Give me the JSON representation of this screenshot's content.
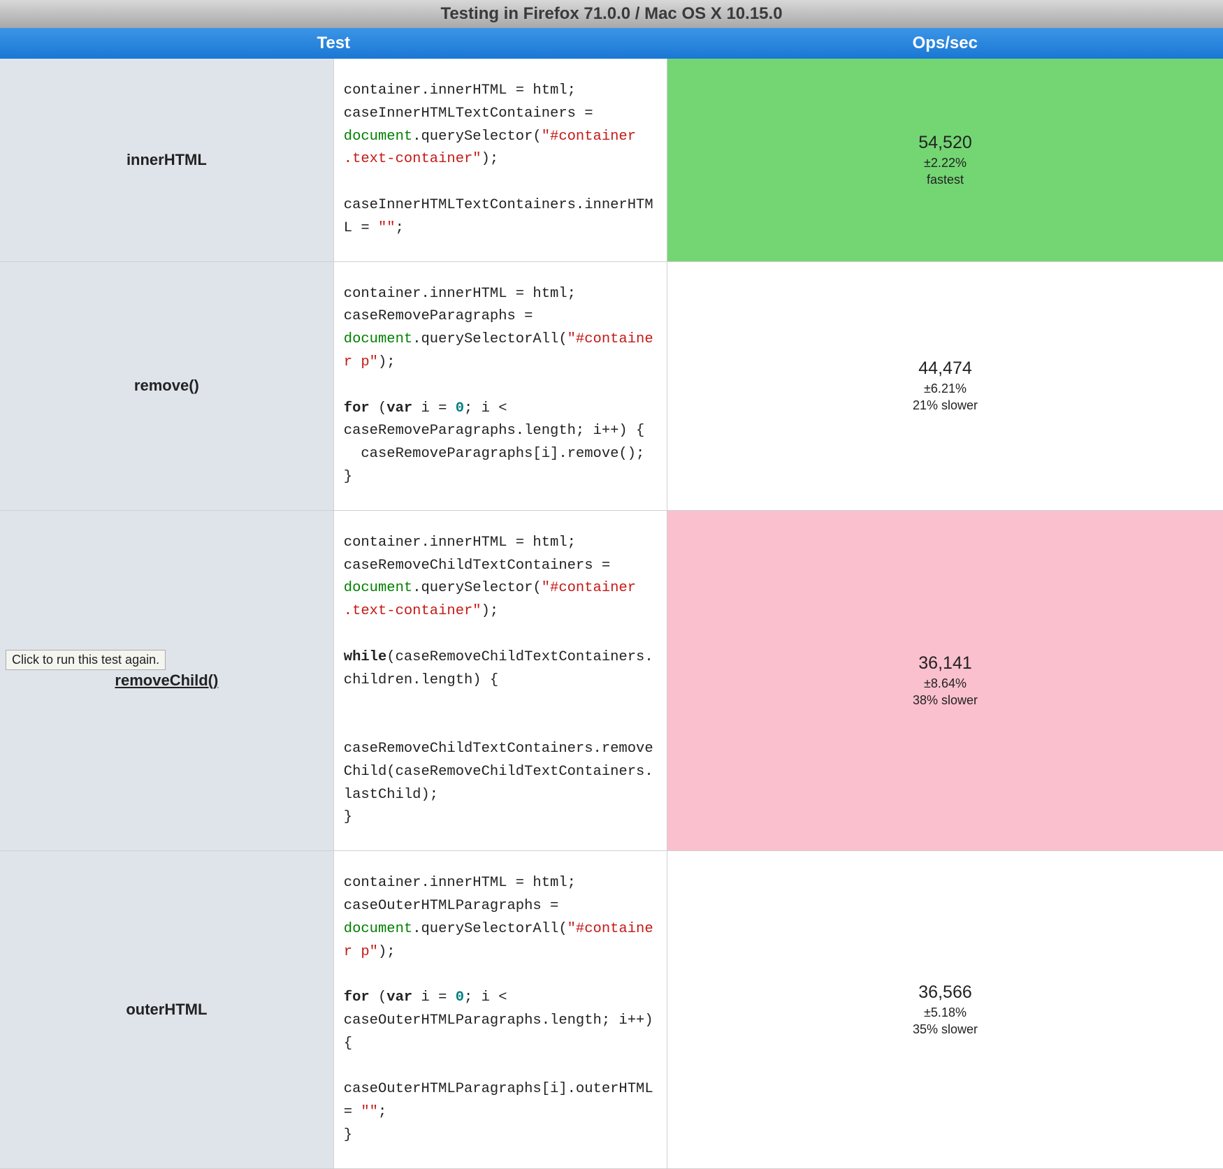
{
  "title": "Testing in Firefox 71.0.0 / Mac OS X 10.15.0",
  "headers": {
    "test": "Test",
    "ops": "Ops/sec"
  },
  "tooltip": "Click to run this test again.",
  "rows": [
    {
      "name": "innerHTML",
      "highlighted": false,
      "code_tokens": [
        {
          "t": "container.innerHTML = html;\ncaseInnerHTMLTextContainers = "
        },
        {
          "t": "document",
          "c": "tok-builtin"
        },
        {
          "t": ".querySelector("
        },
        {
          "t": "\"#container .text-container\"",
          "c": "tok-str"
        },
        {
          "t": ");\n\ncaseInnerHTMLTextContainers.innerHTML = "
        },
        {
          "t": "\"\"",
          "c": "tok-str"
        },
        {
          "t": ";"
        }
      ],
      "ops": "54,520",
      "err": "±2.22%",
      "rank": "fastest",
      "rank_class": "fastest"
    },
    {
      "name": "remove()",
      "highlighted": false,
      "code_tokens": [
        {
          "t": "container.innerHTML = html;\ncaseRemoveParagraphs = "
        },
        {
          "t": "document",
          "c": "tok-builtin"
        },
        {
          "t": ".querySelectorAll("
        },
        {
          "t": "\"#container p\"",
          "c": "tok-str"
        },
        {
          "t": ");\n\n"
        },
        {
          "t": "for",
          "c": "tok-kw"
        },
        {
          "t": " ("
        },
        {
          "t": "var",
          "c": "tok-kw"
        },
        {
          "t": " i = "
        },
        {
          "t": "0",
          "c": "tok-num"
        },
        {
          "t": "; i < caseRemoveParagraphs.length; i++) {\n  caseRemoveParagraphs[i].remove();\n}"
        }
      ],
      "ops": "44,474",
      "err": "±6.21%",
      "rank": "21% slower",
      "rank_class": ""
    },
    {
      "name": "removeChild()",
      "highlighted": true,
      "code_tokens": [
        {
          "t": "container.innerHTML = html;\ncaseRemoveChildTextContainers = "
        },
        {
          "t": "document",
          "c": "tok-builtin"
        },
        {
          "t": ".querySelector("
        },
        {
          "t": "\"#container .text-container\"",
          "c": "tok-str"
        },
        {
          "t": ");\n\n"
        },
        {
          "t": "while",
          "c": "tok-kw"
        },
        {
          "t": "(caseRemoveChildTextContainers.children.length) {\n\n\ncaseRemoveChildTextContainers.removeChild(caseRemoveChildTextContainers.lastChild);\n}"
        }
      ],
      "ops": "36,141",
      "err": "±8.64%",
      "rank": "38% slower",
      "rank_class": "slowest"
    },
    {
      "name": "outerHTML",
      "highlighted": false,
      "code_tokens": [
        {
          "t": "container.innerHTML = html;\ncaseOuterHTMLParagraphs = "
        },
        {
          "t": "document",
          "c": "tok-builtin"
        },
        {
          "t": ".querySelectorAll("
        },
        {
          "t": "\"#container p\"",
          "c": "tok-str"
        },
        {
          "t": ");\n\n"
        },
        {
          "t": "for",
          "c": "tok-kw"
        },
        {
          "t": " ("
        },
        {
          "t": "var",
          "c": "tok-kw"
        },
        {
          "t": " i = "
        },
        {
          "t": "0",
          "c": "tok-num"
        },
        {
          "t": "; i < caseOuterHTMLParagraphs.length; i++) {\n  caseOuterHTMLParagraphs[i].outerHTML = "
        },
        {
          "t": "\"\"",
          "c": "tok-str"
        },
        {
          "t": ";\n}"
        }
      ],
      "ops": "36,566",
      "err": "±5.18%",
      "rank": "35% slower",
      "rank_class": ""
    }
  ]
}
